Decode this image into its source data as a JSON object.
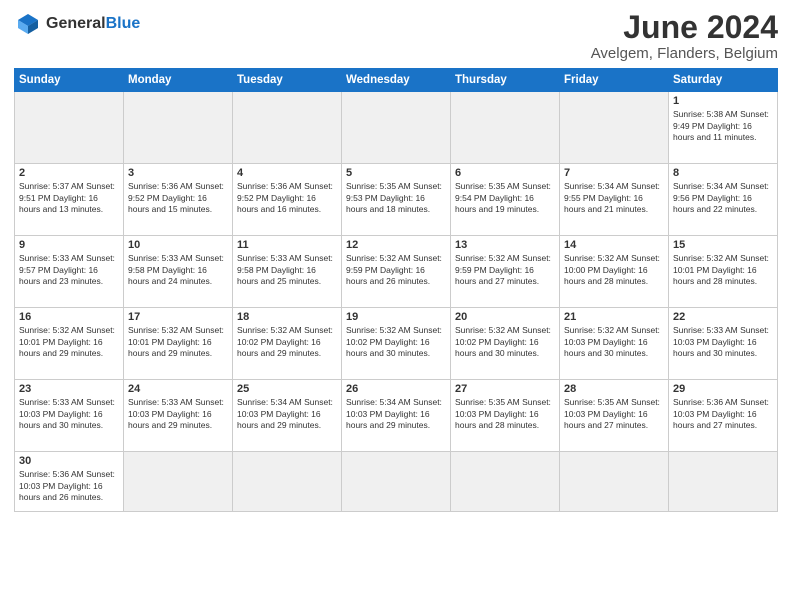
{
  "logo": {
    "line1": "General",
    "line2": "Blue"
  },
  "title": "June 2024",
  "subtitle": "Avelgem, Flanders, Belgium",
  "weekdays": [
    "Sunday",
    "Monday",
    "Tuesday",
    "Wednesday",
    "Thursday",
    "Friday",
    "Saturday"
  ],
  "weeks": [
    [
      {
        "day": "",
        "info": "",
        "empty": true
      },
      {
        "day": "",
        "info": "",
        "empty": true
      },
      {
        "day": "",
        "info": "",
        "empty": true
      },
      {
        "day": "",
        "info": "",
        "empty": true
      },
      {
        "day": "",
        "info": "",
        "empty": true
      },
      {
        "day": "",
        "info": "",
        "empty": true
      },
      {
        "day": "1",
        "info": "Sunrise: 5:38 AM\nSunset: 9:49 PM\nDaylight: 16 hours\nand 11 minutes."
      }
    ],
    [
      {
        "day": "2",
        "info": "Sunrise: 5:37 AM\nSunset: 9:51 PM\nDaylight: 16 hours\nand 13 minutes."
      },
      {
        "day": "3",
        "info": "Sunrise: 5:36 AM\nSunset: 9:52 PM\nDaylight: 16 hours\nand 15 minutes."
      },
      {
        "day": "4",
        "info": "Sunrise: 5:36 AM\nSunset: 9:52 PM\nDaylight: 16 hours\nand 16 minutes."
      },
      {
        "day": "5",
        "info": "Sunrise: 5:35 AM\nSunset: 9:53 PM\nDaylight: 16 hours\nand 18 minutes."
      },
      {
        "day": "6",
        "info": "Sunrise: 5:35 AM\nSunset: 9:54 PM\nDaylight: 16 hours\nand 19 minutes."
      },
      {
        "day": "7",
        "info": "Sunrise: 5:34 AM\nSunset: 9:55 PM\nDaylight: 16 hours\nand 21 minutes."
      },
      {
        "day": "8",
        "info": "Sunrise: 5:34 AM\nSunset: 9:56 PM\nDaylight: 16 hours\nand 22 minutes."
      }
    ],
    [
      {
        "day": "9",
        "info": "Sunrise: 5:33 AM\nSunset: 9:57 PM\nDaylight: 16 hours\nand 23 minutes."
      },
      {
        "day": "10",
        "info": "Sunrise: 5:33 AM\nSunset: 9:58 PM\nDaylight: 16 hours\nand 24 minutes."
      },
      {
        "day": "11",
        "info": "Sunrise: 5:33 AM\nSunset: 9:58 PM\nDaylight: 16 hours\nand 25 minutes."
      },
      {
        "day": "12",
        "info": "Sunrise: 5:32 AM\nSunset: 9:59 PM\nDaylight: 16 hours\nand 26 minutes."
      },
      {
        "day": "13",
        "info": "Sunrise: 5:32 AM\nSunset: 9:59 PM\nDaylight: 16 hours\nand 27 minutes."
      },
      {
        "day": "14",
        "info": "Sunrise: 5:32 AM\nSunset: 10:00 PM\nDaylight: 16 hours\nand 28 minutes."
      },
      {
        "day": "15",
        "info": "Sunrise: 5:32 AM\nSunset: 10:01 PM\nDaylight: 16 hours\nand 28 minutes."
      }
    ],
    [
      {
        "day": "16",
        "info": "Sunrise: 5:32 AM\nSunset: 10:01 PM\nDaylight: 16 hours\nand 29 minutes."
      },
      {
        "day": "17",
        "info": "Sunrise: 5:32 AM\nSunset: 10:01 PM\nDaylight: 16 hours\nand 29 minutes."
      },
      {
        "day": "18",
        "info": "Sunrise: 5:32 AM\nSunset: 10:02 PM\nDaylight: 16 hours\nand 29 minutes."
      },
      {
        "day": "19",
        "info": "Sunrise: 5:32 AM\nSunset: 10:02 PM\nDaylight: 16 hours\nand 30 minutes."
      },
      {
        "day": "20",
        "info": "Sunrise: 5:32 AM\nSunset: 10:02 PM\nDaylight: 16 hours\nand 30 minutes."
      },
      {
        "day": "21",
        "info": "Sunrise: 5:32 AM\nSunset: 10:03 PM\nDaylight: 16 hours\nand 30 minutes."
      },
      {
        "day": "22",
        "info": "Sunrise: 5:33 AM\nSunset: 10:03 PM\nDaylight: 16 hours\nand 30 minutes."
      }
    ],
    [
      {
        "day": "23",
        "info": "Sunrise: 5:33 AM\nSunset: 10:03 PM\nDaylight: 16 hours\nand 30 minutes."
      },
      {
        "day": "24",
        "info": "Sunrise: 5:33 AM\nSunset: 10:03 PM\nDaylight: 16 hours\nand 29 minutes."
      },
      {
        "day": "25",
        "info": "Sunrise: 5:34 AM\nSunset: 10:03 PM\nDaylight: 16 hours\nand 29 minutes."
      },
      {
        "day": "26",
        "info": "Sunrise: 5:34 AM\nSunset: 10:03 PM\nDaylight: 16 hours\nand 29 minutes."
      },
      {
        "day": "27",
        "info": "Sunrise: 5:35 AM\nSunset: 10:03 PM\nDaylight: 16 hours\nand 28 minutes."
      },
      {
        "day": "28",
        "info": "Sunrise: 5:35 AM\nSunset: 10:03 PM\nDaylight: 16 hours\nand 27 minutes."
      },
      {
        "day": "29",
        "info": "Sunrise: 5:36 AM\nSunset: 10:03 PM\nDaylight: 16 hours\nand 27 minutes."
      }
    ],
    [
      {
        "day": "30",
        "info": "Sunrise: 5:36 AM\nSunset: 10:03 PM\nDaylight: 16 hours\nand 26 minutes."
      },
      {
        "day": "",
        "info": "",
        "empty": true
      },
      {
        "day": "",
        "info": "",
        "empty": true
      },
      {
        "day": "",
        "info": "",
        "empty": true
      },
      {
        "day": "",
        "info": "",
        "empty": true
      },
      {
        "day": "",
        "info": "",
        "empty": true
      },
      {
        "day": "",
        "info": "",
        "empty": true
      }
    ]
  ]
}
